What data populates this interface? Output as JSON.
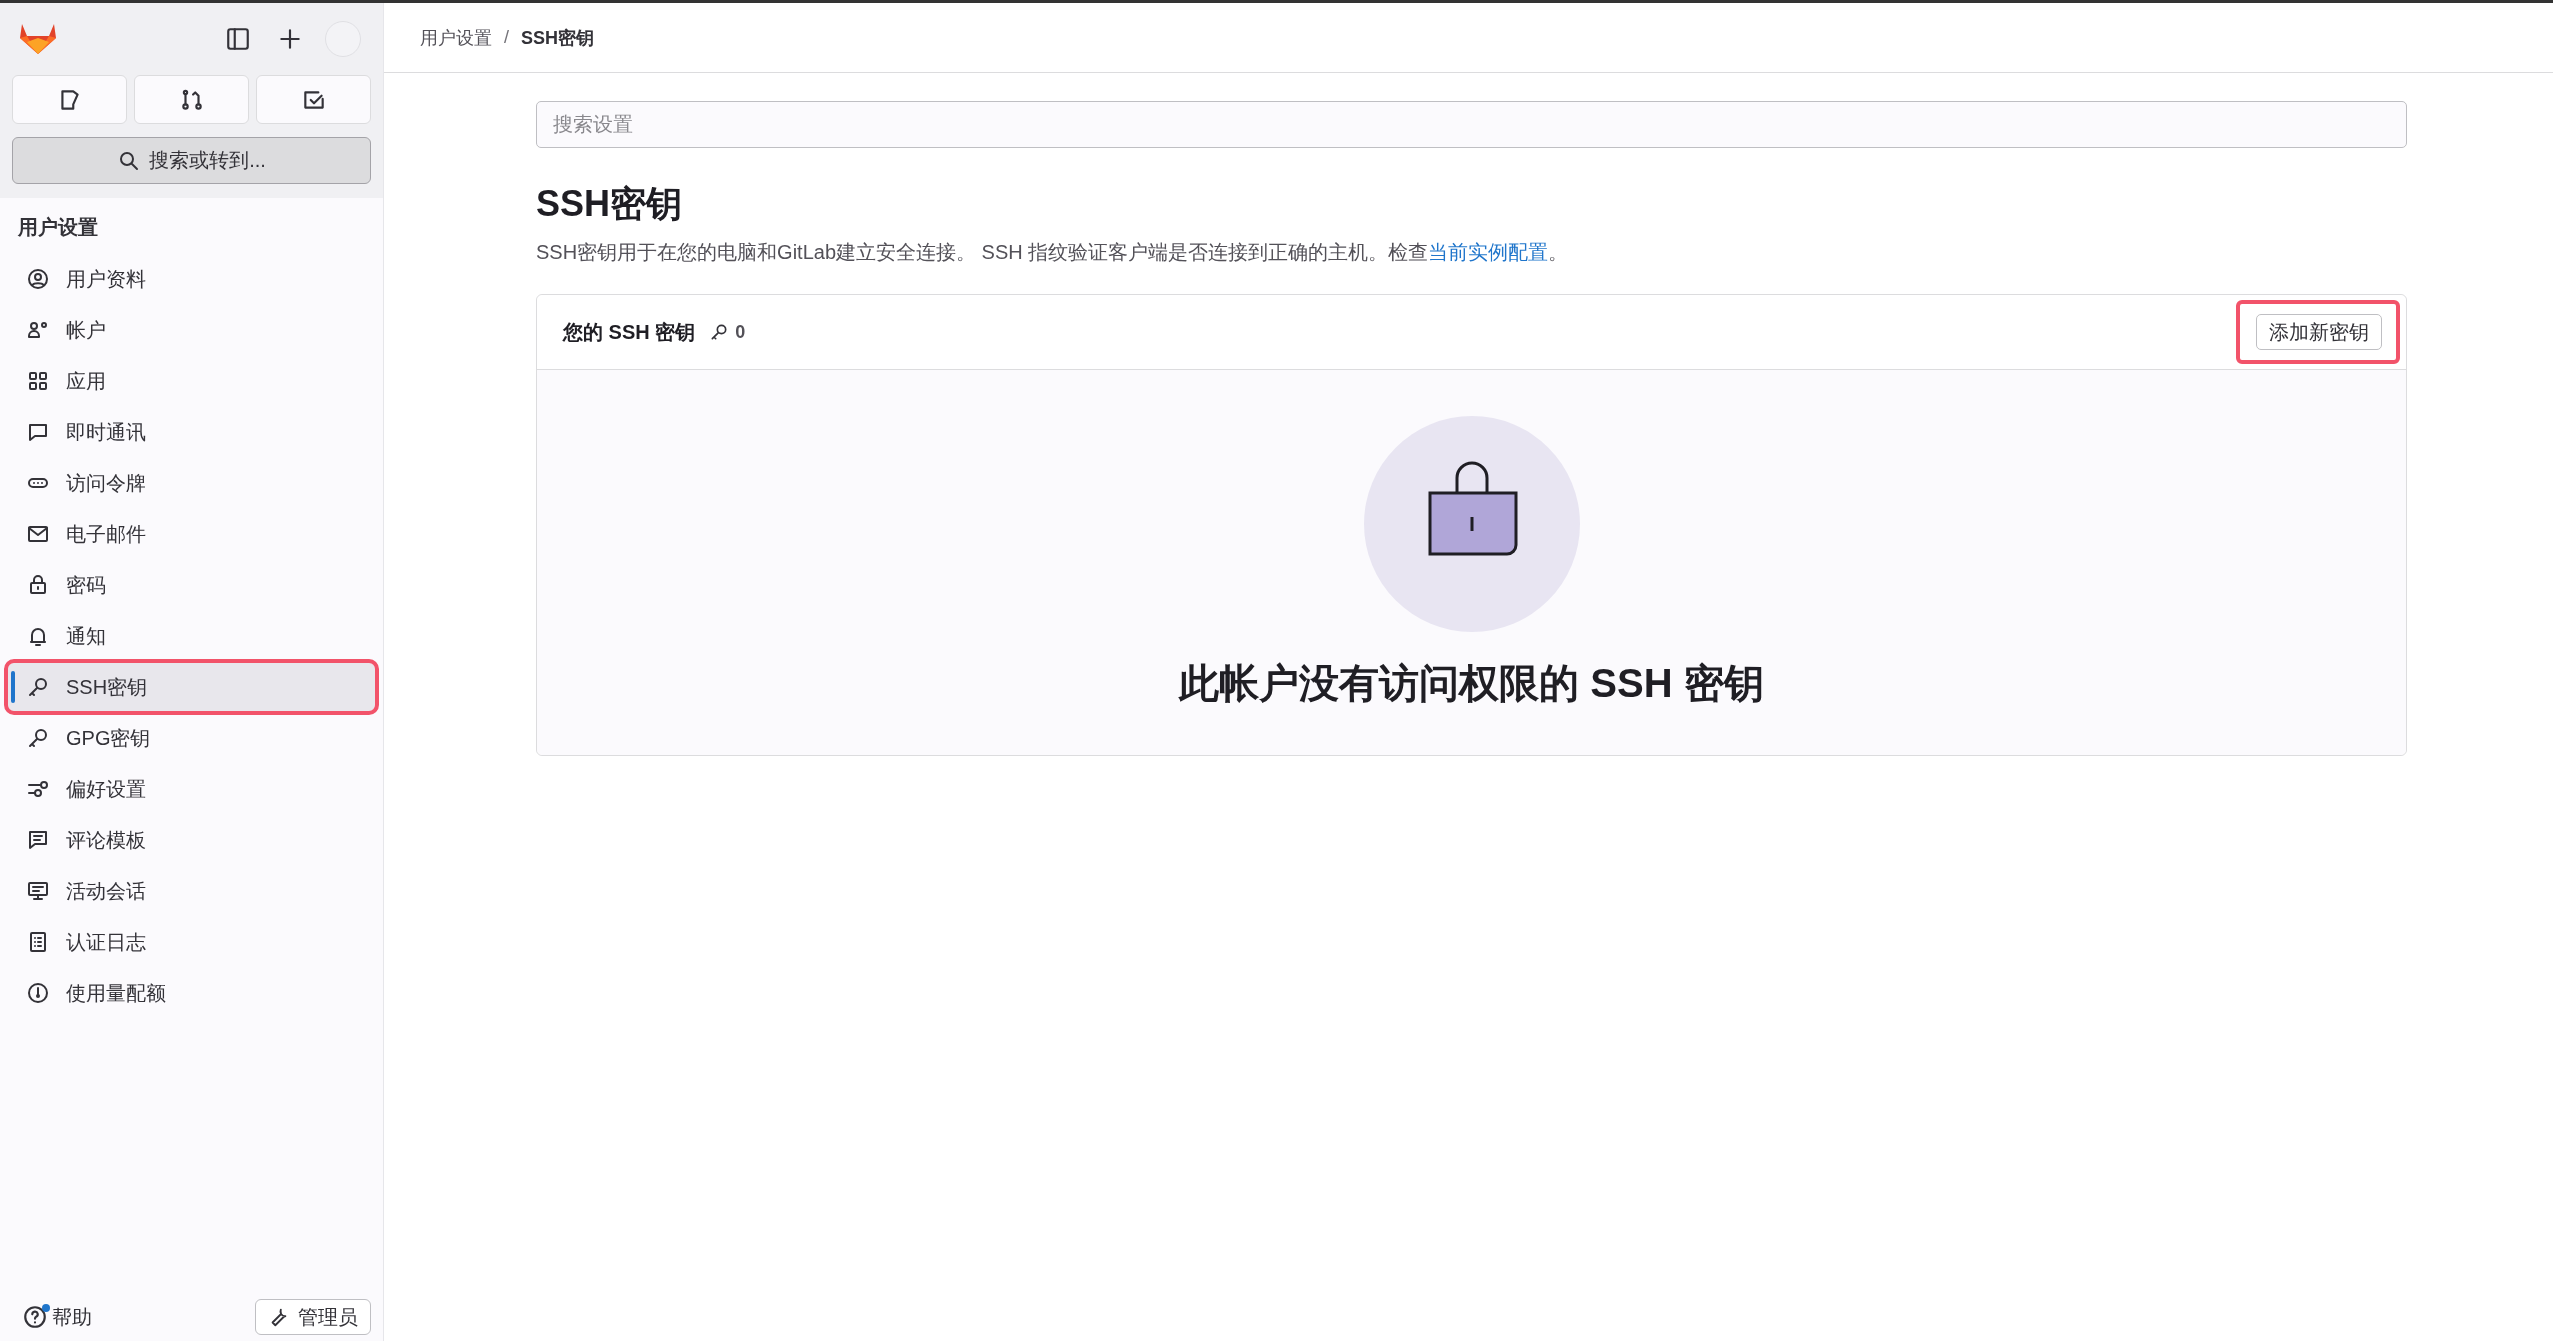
{
  "sidebar": {
    "search_button": "搜索或转到...",
    "section_title": "用户设置",
    "items": [
      {
        "label": "用户资料",
        "selected": false,
        "highlighted": false
      },
      {
        "label": "帐户",
        "selected": false,
        "highlighted": false
      },
      {
        "label": "应用",
        "selected": false,
        "highlighted": false
      },
      {
        "label": "即时通讯",
        "selected": false,
        "highlighted": false
      },
      {
        "label": "访问令牌",
        "selected": false,
        "highlighted": false
      },
      {
        "label": "电子邮件",
        "selected": false,
        "highlighted": false
      },
      {
        "label": "密码",
        "selected": false,
        "highlighted": false
      },
      {
        "label": "通知",
        "selected": false,
        "highlighted": false
      },
      {
        "label": "SSH密钥",
        "selected": true,
        "highlighted": true
      },
      {
        "label": "GPG密钥",
        "selected": false,
        "highlighted": false
      },
      {
        "label": "偏好设置",
        "selected": false,
        "highlighted": false
      },
      {
        "label": "评论模板",
        "selected": false,
        "highlighted": false
      },
      {
        "label": "活动会话",
        "selected": false,
        "highlighted": false
      },
      {
        "label": "认证日志",
        "selected": false,
        "highlighted": false
      },
      {
        "label": "使用量配额",
        "selected": false,
        "highlighted": false
      }
    ],
    "help": {
      "label": "帮助",
      "notification": true
    },
    "admin_button": "管理员"
  },
  "breadcrumb": {
    "separator": "/",
    "items": [
      {
        "label": "用户设置",
        "current": false
      },
      {
        "label": "SSH密钥",
        "current": true
      }
    ]
  },
  "search": {
    "placeholder": "搜索设置"
  },
  "page_title": "SSH密钥",
  "description": {
    "text": "SSH密钥用于在您的电脑和GitLab建立安全连接。 SSH 指纹验证客户端是否连接到正确的主机。检查",
    "link": "当前实例配置",
    "suffix": "。"
  },
  "card": {
    "title": "您的 SSH 密钥",
    "count": "0",
    "add_button": {
      "label": "添加新密钥",
      "highlighted": true
    },
    "empty_title": "此帐户没有访问权限的 SSH 密钥"
  }
}
